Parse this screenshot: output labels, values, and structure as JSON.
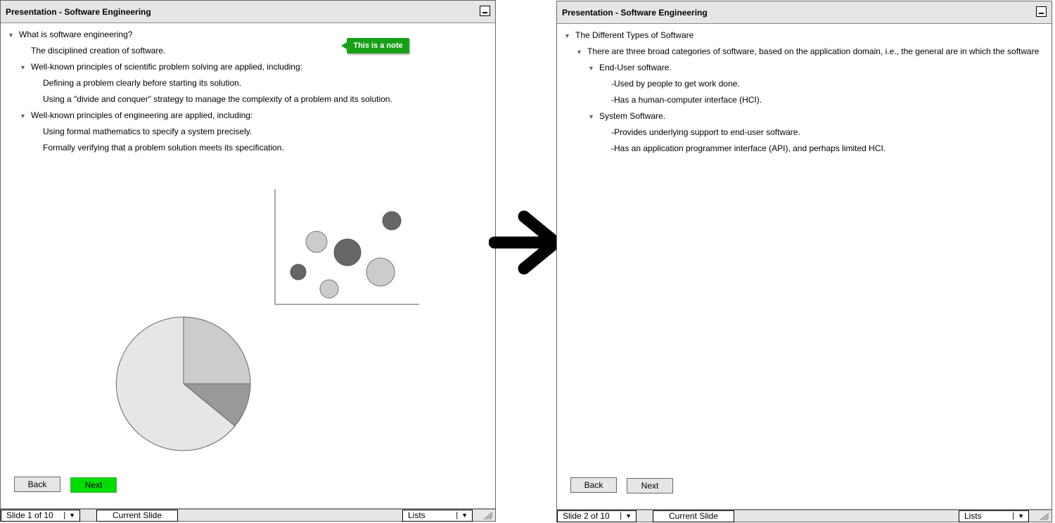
{
  "slide1": {
    "title": "Presentation - Software Engineering",
    "tree": [
      {
        "level": 0,
        "toggle": true,
        "text": "What is software engineering?"
      },
      {
        "level": 1,
        "toggle": false,
        "text": "The disciplined creation of software."
      },
      {
        "level": 1,
        "toggle": true,
        "text": "Well-known principles of scientific problem solving are applied, including:"
      },
      {
        "level": 2,
        "toggle": false,
        "text": "Defining a problem clearly before starting its solution."
      },
      {
        "level": 2,
        "toggle": false,
        "text": "Using a \"divide and conquer\" strategy to manage the complexity of a problem and its solution."
      },
      {
        "level": 1,
        "toggle": true,
        "text": "Well-known principles of engineering are applied, including:"
      },
      {
        "level": 2,
        "toggle": false,
        "text": "Using formal mathematics to specify a system precisely."
      },
      {
        "level": 2,
        "toggle": false,
        "text": "Formally verifying that a problem solution meets its specification."
      }
    ],
    "note": "This is a note",
    "back": "Back",
    "next": "Next",
    "slide_select": "Slide 1 of 10",
    "current_slide": "Current Slide",
    "view_select": "Lists",
    "next_color": "#00dd00"
  },
  "slide2": {
    "title": "Presentation - Software Engineering",
    "tree": [
      {
        "level": 0,
        "toggle": true,
        "text": "The Different Types of Software"
      },
      {
        "level": 1,
        "toggle": true,
        "text": "There are three broad categories of software, based on the application domain, i.e., the general are in which the software"
      },
      {
        "level": 2,
        "toggle": true,
        "text": "End-User software."
      },
      {
        "level": 3,
        "toggle": false,
        "text": "-Used by people to get work done."
      },
      {
        "level": 3,
        "toggle": false,
        "text": "-Has a human-computer interface (HCI)."
      },
      {
        "level": 2,
        "toggle": true,
        "text": "System Software."
      },
      {
        "level": 3,
        "toggle": false,
        "text": "-Provides underlying support to end-user software."
      },
      {
        "level": 3,
        "toggle": false,
        "text": "-Has an application programmer interface (API), and perhaps limited HCI."
      }
    ],
    "back": "Back",
    "next": "Next",
    "slide_select": "Slide 2 of 10",
    "current_slide": "Current Slide",
    "view_select": "Lists"
  },
  "icons": {
    "toggle": "triangle-down",
    "minimize": "minimize",
    "dropdown": "caret-down",
    "flow": "arrow-right"
  }
}
